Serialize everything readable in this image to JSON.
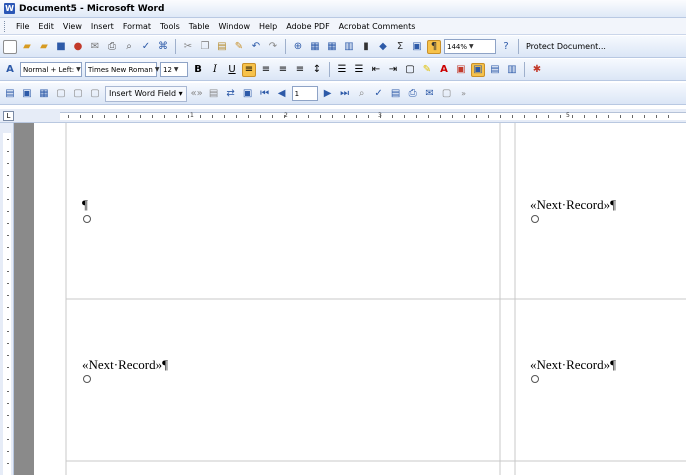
{
  "window": {
    "title": "Document5 - Microsoft Word"
  },
  "menu": [
    "File",
    "Edit",
    "View",
    "Insert",
    "Format",
    "Tools",
    "Table",
    "Window",
    "Help",
    "Adobe PDF",
    "Acrobat Comments"
  ],
  "standard_toolbar": {
    "zoom": "144%",
    "protect_label": "Protect Document..."
  },
  "formatting_toolbar": {
    "style": "Normal + Left:",
    "font": "Times New Roman",
    "size": "12"
  },
  "mailmerge_toolbar": {
    "insert_word_field": "Insert Word Field",
    "record": "1"
  },
  "document": {
    "cells": [
      {
        "text": "¶",
        "mark": "○"
      },
      {
        "text": "«Next·Record»¶",
        "mark": "○"
      },
      {
        "text": "«Next·Record»¶",
        "mark": "○"
      },
      {
        "text": "«Next·Record»¶",
        "mark": "○"
      }
    ]
  },
  "ruler_numbers": [
    "1",
    "2",
    "3",
    "5"
  ]
}
